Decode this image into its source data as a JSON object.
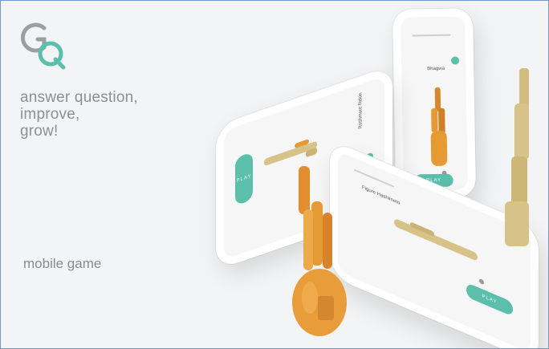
{
  "brand": {
    "logo_icon": "gq-logo-icon",
    "colors": {
      "accent": "#5bbfac",
      "logo_grey": "#999999",
      "text_grey": "#8f8f8f",
      "statue_orange": "#e59a33",
      "statue_sand": "#d7c287",
      "frame_border": "#6f98c4"
    }
  },
  "tagline": {
    "line1": "answer question,",
    "line2": "improve,",
    "line3": "grow!"
  },
  "subtitle": "mobile game",
  "phones": {
    "upright": {
      "question": "Bhagwa",
      "button": "PLAY"
    },
    "tilted_left": {
      "question": "Rushmore Rekin",
      "button": "PLAY"
    },
    "tilted_front": {
      "question": "Figure Hashimoto",
      "button": "PLAY"
    }
  }
}
